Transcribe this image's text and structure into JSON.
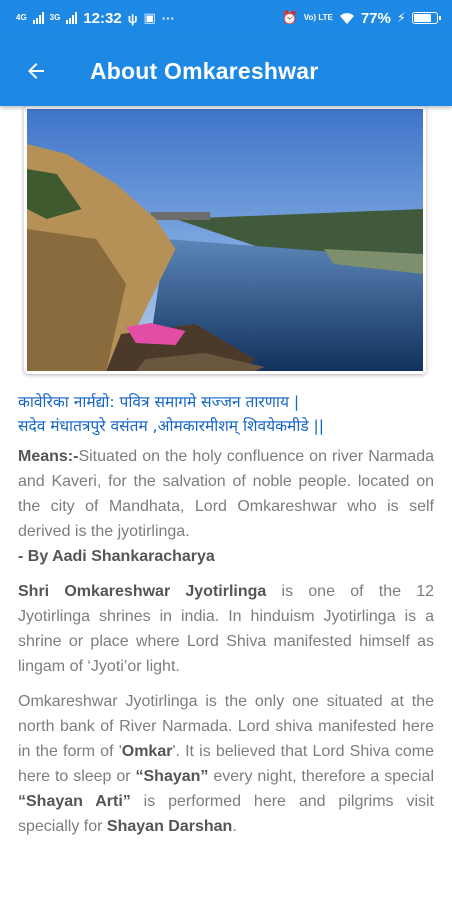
{
  "status_bar": {
    "time": "12:32",
    "network_1": "4G",
    "network_2": "3G",
    "battery": "77%",
    "battery_level": 0.77,
    "volte": "Vo) LTE"
  },
  "app_bar": {
    "title": "About Omkareshwar",
    "color": "#1e88e5"
  },
  "shloka": {
    "line1": "कावेरिका नार्मद्यो: पवित्र समागमे सज्जन तारणाय |",
    "line2": "सदेव मंधातत्रपुरे वसंतम ,ओमकारमीशम् शिवयेकमीडे ||",
    "color": "#1565c0"
  },
  "means": {
    "label": "Means:-",
    "text": "Situated on the holy confluence on river Narmada and Kaveri, for the salvation of noble people. located on the city of Mandhata, Lord Omkareshwar who is self derived is the jyotirlinga.",
    "attribution": "- By Aadi Shankaracharya"
  },
  "para2": {
    "bold": "Shri Omkareshwar Jyotirlinga",
    "text": " is one of the 12 Jyotirlinga shrines in india. In hinduism Jyotirlinga is a shrine or place where Lord Shiva manifested himself as lingam of ‘Jyoti’or light."
  },
  "para3": {
    "t1": "Omkareshwar Jyotirlinga is the only one situated at the north bank of River Narmada. Lord shiva manifested here in the form of '",
    "b1": "Omkar",
    "t2": "'. It is believed that Lord Shiva come here to sleep or ",
    "b2": "“Shayan”",
    "t3": " every night, therefore a special ",
    "b3": "“Shayan Arti”",
    "t4": " is performed here and pilgrims visit specially for ",
    "b4": "Shayan Darshan",
    "t5": "."
  }
}
